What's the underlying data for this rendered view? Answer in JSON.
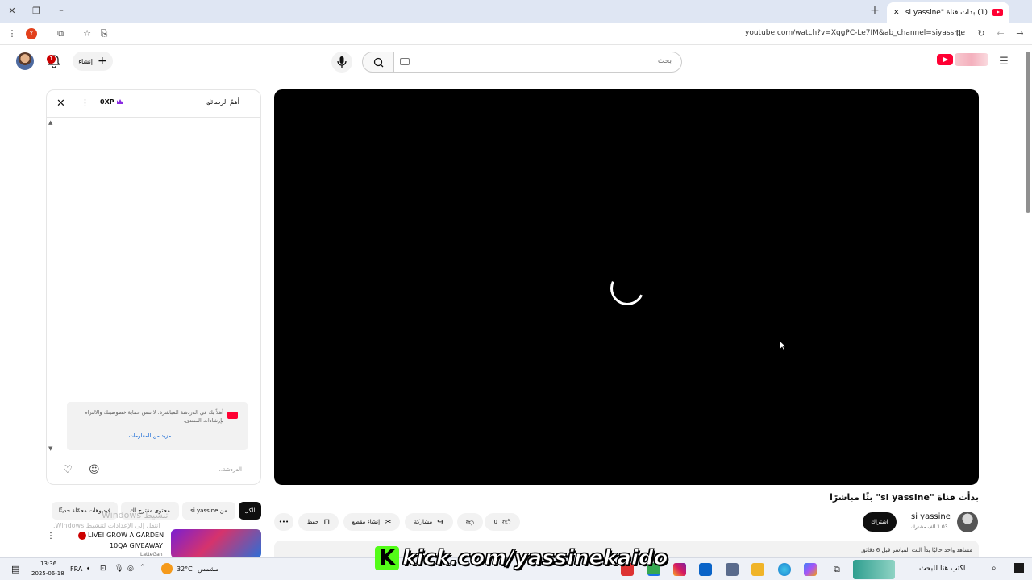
{
  "browser": {
    "tab_title": "(1) بدأت قناة \"si yassine\" بثًا مباشرًا",
    "tab_badge": "(1)",
    "url": "youtube.com/watch?v=XqgPC-Le7IM&ab_channel=siyassine",
    "profile_letter": "Y",
    "new_tab_symbol": "+",
    "close_tab_symbol": "✕"
  },
  "header": {
    "search_placeholder": "بحث",
    "create_label": "إنشاء",
    "notification_count": "1",
    "logo_brand_color": "#ff0033"
  },
  "chat": {
    "top_chat_label": "أهمّ الرسائل",
    "xp_label": "0XP",
    "notice_text": "أهلاً بك في الدردشة المباشرة. لا تنسَ حماية خصوصيتك والالتزام بإرشادات المنتدى.",
    "notice_link": "مزيد من المعلومات",
    "input_placeholder": "الدردشة..."
  },
  "video": {
    "title": "بدأت قناة \"si yassine\" بثًا مباشرًا",
    "channel_name": "si yassine",
    "subscriber_count": "1.03 ألف مشترك",
    "subscribe_label": "اشتراك",
    "like_count": "0",
    "share_label": "مشاركة",
    "clip_label": "إنشاء مقطع",
    "save_label": "حفظ",
    "description_snippet": "مشاهد واحد حاليًا  بدأ البث المباشر قبل 6 دقائق"
  },
  "side": {
    "chips": [
      "الكل",
      "من si yassine",
      "محتوى مقترح لك",
      "فيديوهات محمّلة حديثًا"
    ],
    "rec_title_line1": "LIVE! GROW A GARDEN",
    "rec_title_line2": "10QA GIVEAWAY",
    "rec_channel": "LatteGan",
    "live_color": "#cc0000"
  },
  "watermark": {
    "line1": "تنشيط Windows",
    "line2": "انتقل إلى الإعدادات لتنشيط Windows."
  },
  "overlay": {
    "kick_letter": "K",
    "kick_text": "kick.com/yassinekaido",
    "kick_color": "#53fc18"
  },
  "taskbar": {
    "search_placeholder": "اكتب هنا للبحث",
    "weather_temp": "32°C",
    "weather_label": "مشمس",
    "language": "FRA",
    "time": "13:36",
    "date": "2025-06-18"
  }
}
